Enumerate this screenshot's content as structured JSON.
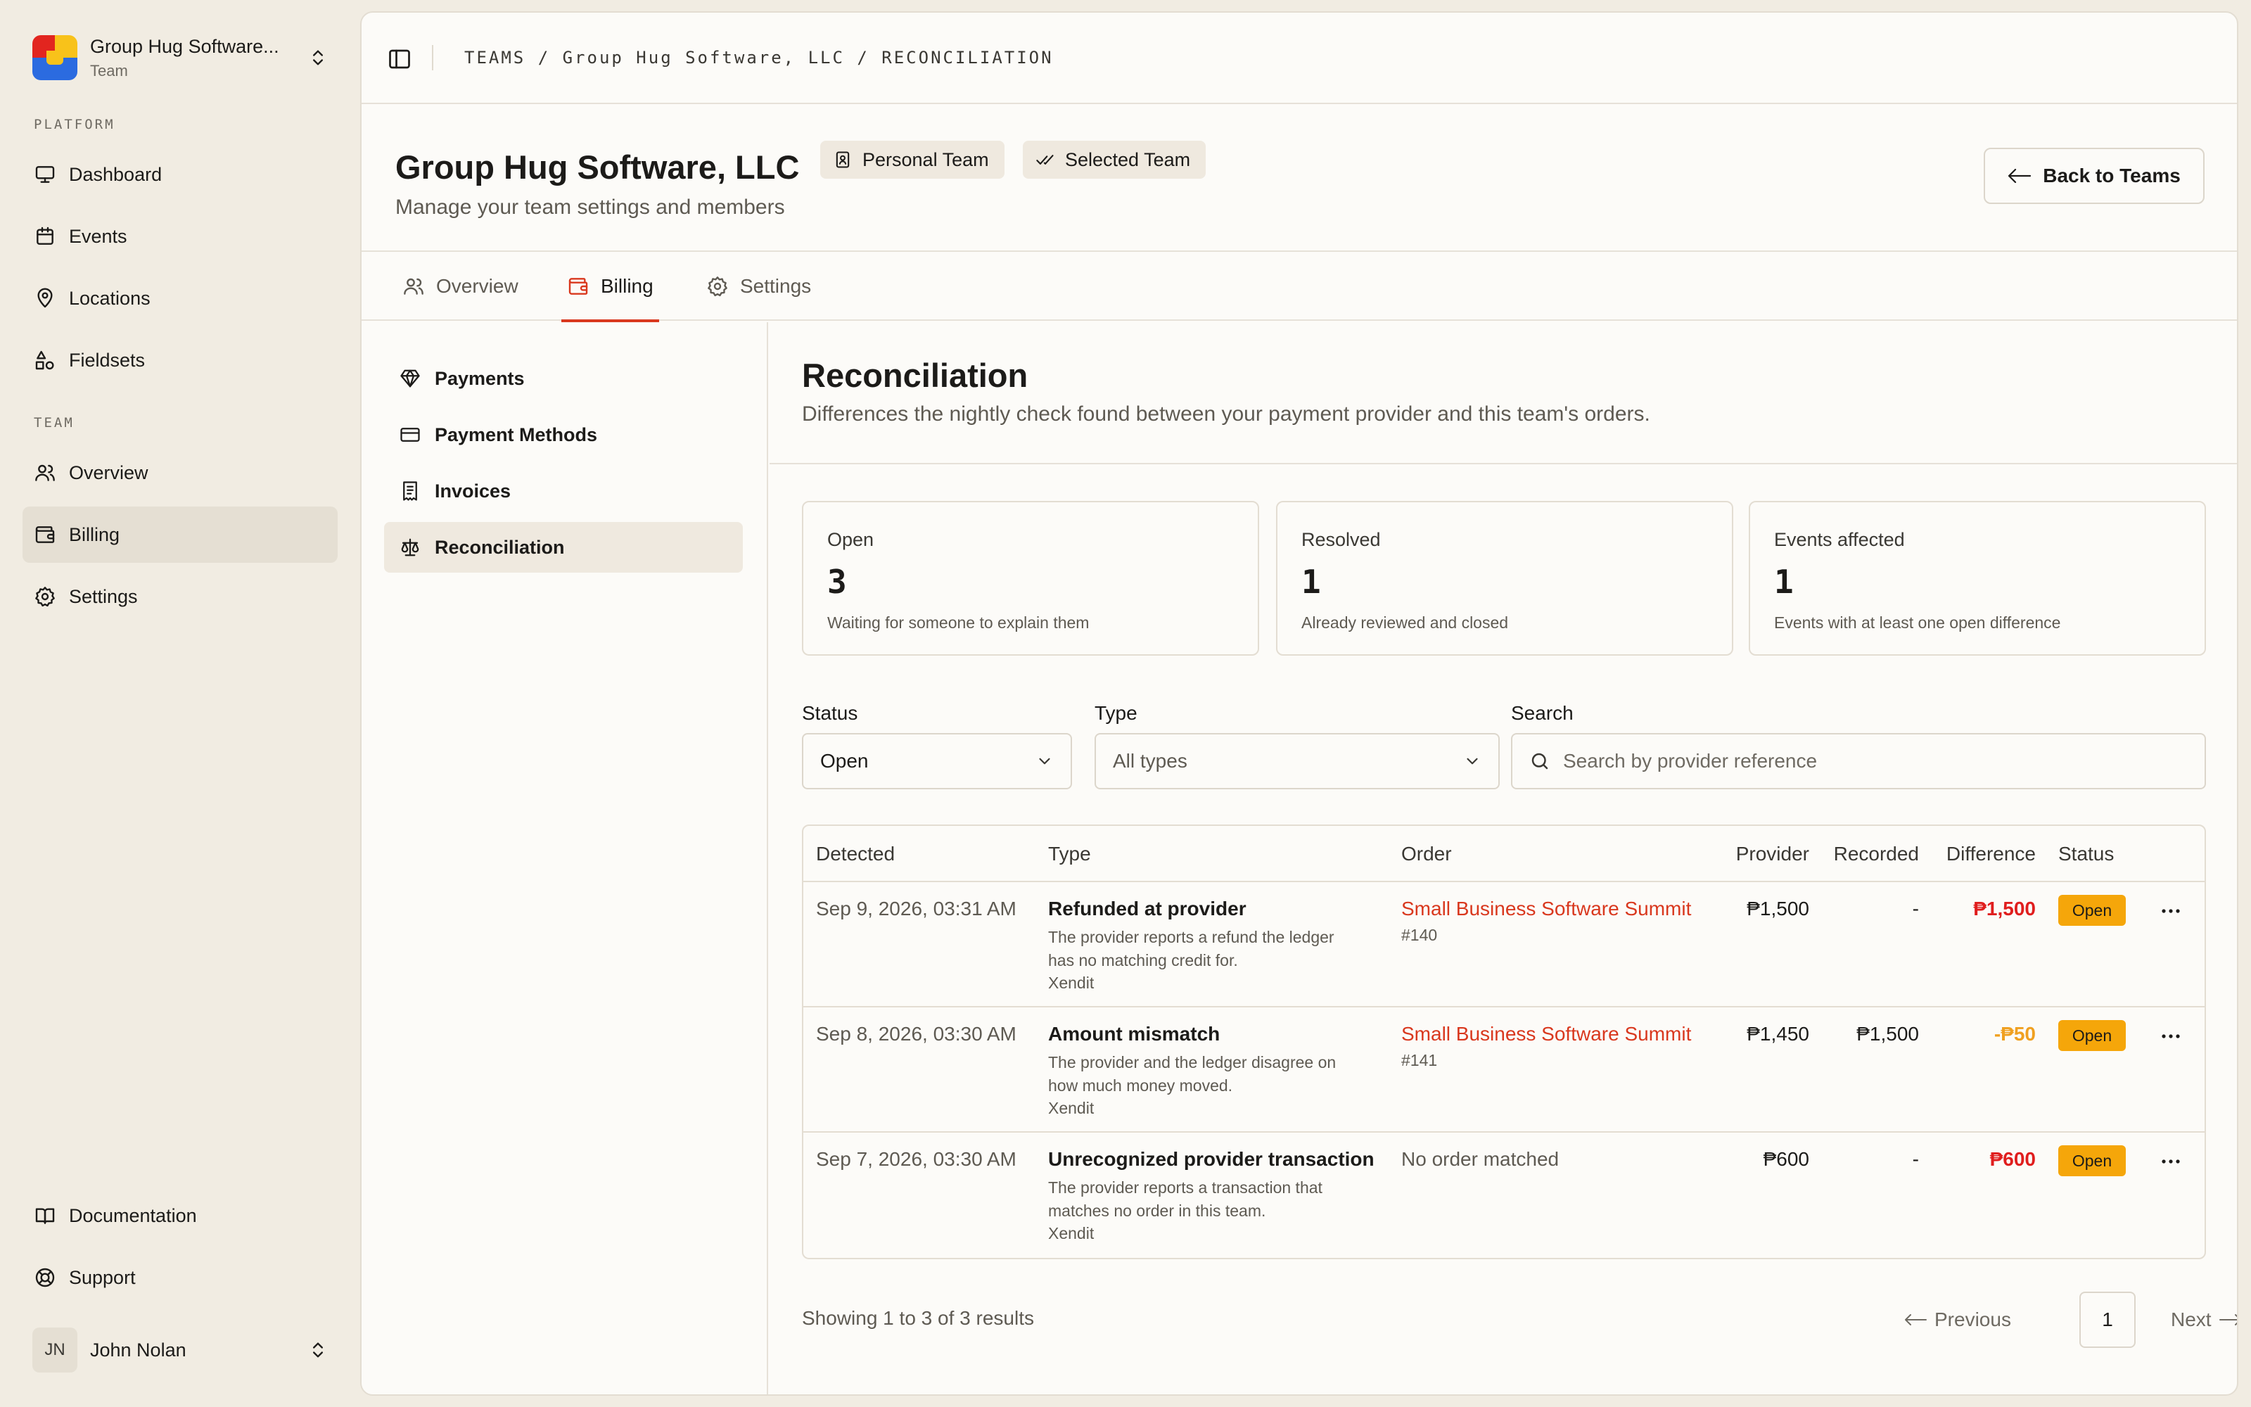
{
  "team_switcher": {
    "name": "Group Hug Software...",
    "role": "Team"
  },
  "sidebar": {
    "platform_label": "PLATFORM",
    "platform_items": [
      {
        "label": "Dashboard",
        "icon": "monitor-icon"
      },
      {
        "label": "Events",
        "icon": "calendar-icon"
      },
      {
        "label": "Locations",
        "icon": "map-pin-icon"
      },
      {
        "label": "Fieldsets",
        "icon": "shapes-icon"
      }
    ],
    "team_label": "TEAM",
    "team_items": [
      {
        "label": "Overview",
        "icon": "users-icon"
      },
      {
        "label": "Billing",
        "icon": "wallet-icon",
        "active": true
      },
      {
        "label": "Settings",
        "icon": "gear-icon"
      }
    ],
    "footer_items": [
      {
        "label": "Documentation",
        "icon": "book-icon"
      },
      {
        "label": "Support",
        "icon": "lifebuoy-icon"
      }
    ],
    "user": {
      "initials": "JN",
      "name": "John Nolan"
    }
  },
  "breadcrumb": "TEAMS / Group Hug Software, LLC / RECONCILIATION",
  "header": {
    "title": "Group Hug Software, LLC",
    "badges": [
      {
        "label": "Personal Team",
        "icon": "id-badge-icon"
      },
      {
        "label": "Selected Team",
        "icon": "double-check-icon"
      }
    ],
    "subtitle": "Manage your team settings and members",
    "back_button": "Back to Teams"
  },
  "tabs": [
    {
      "label": "Overview",
      "icon": "users-icon"
    },
    {
      "label": "Billing",
      "icon": "wallet-icon",
      "active": true
    },
    {
      "label": "Settings",
      "icon": "gear-icon"
    }
  ],
  "subnav": [
    {
      "label": "Payments",
      "icon": "gem-icon"
    },
    {
      "label": "Payment Methods",
      "icon": "credit-card-icon"
    },
    {
      "label": "Invoices",
      "icon": "receipt-icon"
    },
    {
      "label": "Reconciliation",
      "icon": "scale-icon",
      "active": true
    }
  ],
  "reconciliation": {
    "title": "Reconciliation",
    "description": "Differences the nightly check found between your payment provider and this team's orders.",
    "stats": [
      {
        "label": "Open",
        "value": "3",
        "note": "Waiting for someone to explain them"
      },
      {
        "label": "Resolved",
        "value": "1",
        "note": "Already reviewed and closed"
      },
      {
        "label": "Events affected",
        "value": "1",
        "note": "Events with at least one open difference"
      }
    ],
    "filters": {
      "status_label": "Status",
      "status_value": "Open",
      "type_label": "Type",
      "type_value": "All types",
      "search_label": "Search",
      "search_placeholder": "Search by provider reference"
    },
    "columns": [
      "Detected",
      "Type",
      "Order",
      "Provider",
      "Recorded",
      "Difference",
      "Status"
    ],
    "rows": [
      {
        "detected": "Sep 9, 2026, 03:31 AM",
        "type": "Refunded at provider",
        "type_desc": "The provider reports a refund the ledger has no matching credit for.",
        "provider_name": "Xendit",
        "order": "Small Business Software Summit",
        "order_num": "#140",
        "provider": "₱1,500",
        "recorded": "-",
        "difference": "₱1,500",
        "diff_color": "#e01e1e",
        "status": "Open"
      },
      {
        "detected": "Sep 8, 2026, 03:30 AM",
        "type": "Amount mismatch",
        "type_desc": "The provider and the ledger disagree on how much money moved.",
        "provider_name": "Xendit",
        "order": "Small Business Software Summit",
        "order_num": "#141",
        "provider": "₱1,450",
        "recorded": "₱1,500",
        "difference": "-₱50",
        "diff_color": "#f0a020",
        "status": "Open"
      },
      {
        "detected": "Sep 7, 2026, 03:30 AM",
        "type": "Unrecognized provider transaction",
        "type_desc": "The provider reports a transaction that matches no order in this team.",
        "provider_name": "Xendit",
        "order": "No order matched",
        "order_num": "",
        "provider": "₱600",
        "recorded": "-",
        "difference": "₱600",
        "diff_color": "#e01e1e",
        "status": "Open"
      }
    ],
    "results_text": "Showing 1 to 3 of 3 results",
    "pagination": {
      "previous": "Previous",
      "page": "1",
      "next": "Next"
    }
  },
  "colors": {
    "accent": "#d9381e",
    "status_open": "#f5a60a",
    "background": "#f1ece2",
    "panel": "#fcfbf8"
  }
}
